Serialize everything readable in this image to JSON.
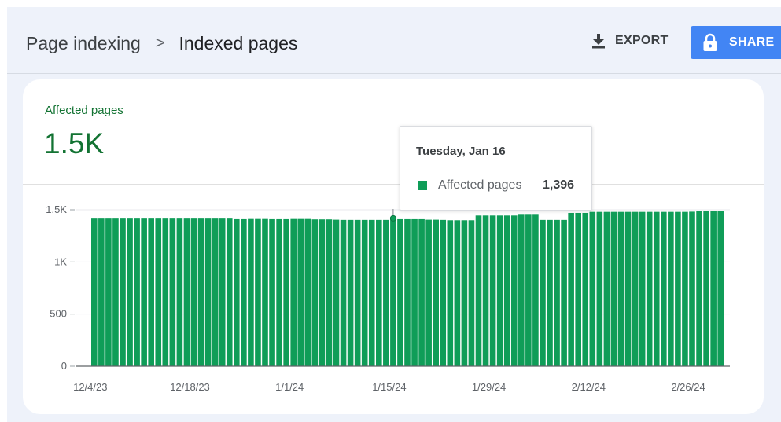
{
  "breadcrumb": {
    "parent": "Page indexing",
    "separator": ">",
    "current": "Indexed pages"
  },
  "actions": {
    "export_label": "EXPORT",
    "share_label": "SHARE"
  },
  "metric": {
    "label": "Affected pages",
    "value": "1.5K"
  },
  "colors": {
    "accent_green": "#0f9d58",
    "metric_text": "#137333",
    "share_blue": "#4285f4"
  },
  "icons": {
    "export": "download-icon",
    "share": "lock-icon"
  },
  "tooltip": {
    "date": "Tuesday, Jan 16",
    "series": "Affected pages",
    "value": "1,396"
  },
  "chart_data": {
    "type": "bar",
    "series_name": "Affected pages",
    "y_ticks": [
      "0",
      "500",
      "1K",
      "1.5K"
    ],
    "y_tick_values": [
      0,
      500,
      1000,
      1500
    ],
    "ylim": [
      0,
      1500
    ],
    "x_tick_labels": [
      "12/4/23",
      "12/18/23",
      "1/1/24",
      "1/15/24",
      "1/29/24",
      "2/12/24",
      "2/26/24"
    ],
    "x_tick_indices": [
      0,
      14,
      28,
      42,
      56,
      70,
      84
    ],
    "start_date": "12/4/23",
    "highlight_date": "1/16/24",
    "grid": true,
    "values": [
      1416,
      1416,
      1416,
      1416,
      1416,
      1416,
      1416,
      1416,
      1416,
      1416,
      1416,
      1416,
      1416,
      1416,
      1416,
      1416,
      1416,
      1416,
      1416,
      1416,
      1410,
      1410,
      1412,
      1412,
      1412,
      1410,
      1410,
      1410,
      1412,
      1412,
      1412,
      1408,
      1408,
      1408,
      1405,
      1403,
      1403,
      1403,
      1403,
      1403,
      1403,
      1403,
      1418,
      1410,
      1410,
      1410,
      1410,
      1405,
      1405,
      1403,
      1400,
      1400,
      1400,
      1400,
      1445,
      1445,
      1445,
      1445,
      1445,
      1445,
      1460,
      1460,
      1460,
      1403,
      1403,
      1403,
      1403,
      1470,
      1470,
      1470,
      1480,
      1480,
      1480,
      1480,
      1480,
      1480,
      1480,
      1480,
      1480,
      1480,
      1480,
      1480,
      1480,
      1480,
      1482,
      1490,
      1490,
      1490,
      1490
    ]
  }
}
